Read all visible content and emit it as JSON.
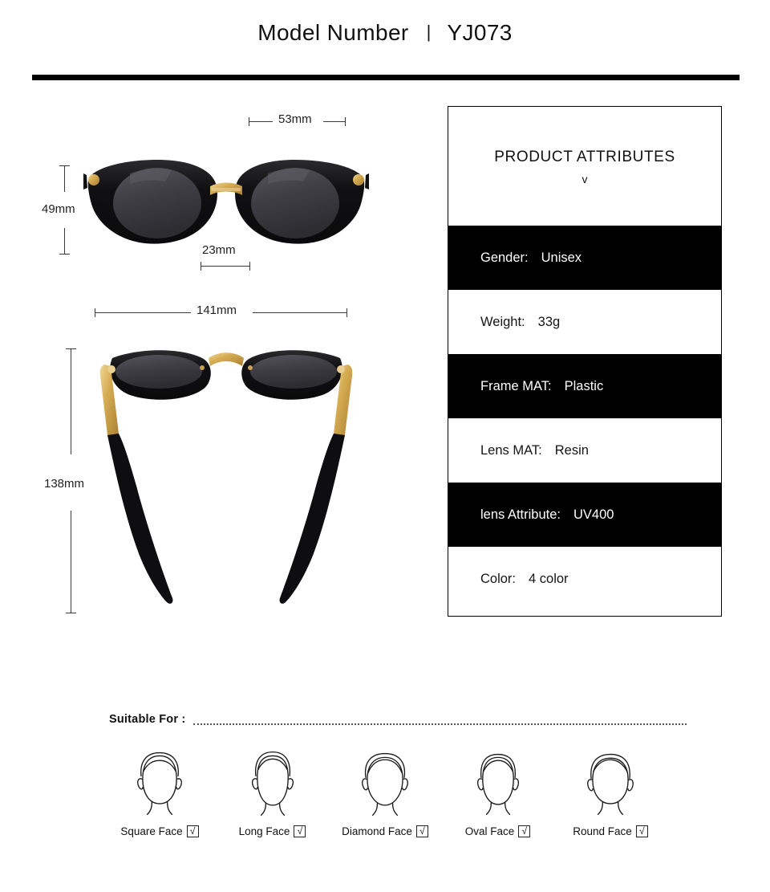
{
  "header": {
    "title": "Model Number",
    "separator": "|",
    "model": "YJ073"
  },
  "dimensions": {
    "lens_width": "53mm",
    "lens_height": "49mm",
    "bridge": "23mm",
    "frame_width": "141mm",
    "temple_length": "138mm"
  },
  "attributes_panel": {
    "title": "PRODUCT ATTRIBUTES",
    "chevron": "v",
    "rows": [
      {
        "label": "Gender:",
        "value": "Unisex",
        "style": "dark"
      },
      {
        "label": "Weight:",
        "value": "33g",
        "style": "light"
      },
      {
        "label": "Frame MAT:",
        "value": "Plastic",
        "style": "dark"
      },
      {
        "label": "Lens MAT:",
        "value": "Resin",
        "style": "light"
      },
      {
        "label": "lens Attribute:",
        "value": "UV400",
        "style": "dark"
      },
      {
        "label": "Color:",
        "value": "4  color",
        "style": "light"
      }
    ]
  },
  "suitable_for": {
    "label": "Suitable For :",
    "faces": [
      {
        "name": "Square Face",
        "checked": "√"
      },
      {
        "name": "Long Face",
        "checked": "√"
      },
      {
        "name": "Diamond Face",
        "checked": "√"
      },
      {
        "name": "Oval Face",
        "checked": "√"
      },
      {
        "name": "Round Face",
        "checked": "√"
      }
    ]
  },
  "colors": {
    "rule": "#000000",
    "panel_border": "#000000",
    "row_dark_bg": "#000000",
    "row_dark_text": "#ffffff",
    "row_light_bg": "#ffffff",
    "row_light_text": "#151515",
    "frame_black": "#121212",
    "lens_gray": "#3b3b3f",
    "metal_gold": "#d8b35e"
  }
}
